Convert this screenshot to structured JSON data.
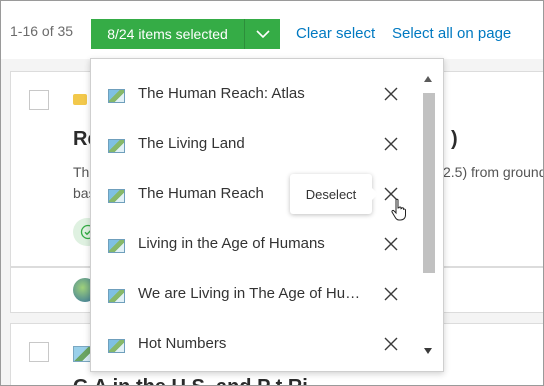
{
  "toolbar": {
    "count": "1-16 of 35",
    "selected_label": "8/24 items selected",
    "clear_select": "Clear select",
    "select_all": "Select all on page"
  },
  "background": {
    "card1_title_start": "Re",
    "card1_title_end": ")",
    "card1_text_start": "Thi",
    "card1_text_end": "2.5) from ground",
    "card1_text_line2": "bas",
    "card2_title": "G     A    in the U.S. and P  t  Ri"
  },
  "dropdown": {
    "items": [
      {
        "label": "The Human Reach: Atlas"
      },
      {
        "label": "The Living Land"
      },
      {
        "label": "The Human Reach"
      },
      {
        "label": "Living in the Age of Humans"
      },
      {
        "label": "We are Living in The Age of Humans"
      },
      {
        "label": "Hot Numbers"
      }
    ]
  },
  "tooltip": {
    "text": "Deselect"
  },
  "colors": {
    "accent_green": "#35ac46",
    "link_blue": "#0079c1"
  },
  "icons": {
    "dropdown_toggle": "chevron-down-icon",
    "remove": "close-icon",
    "thumbnail": "web-map-icon",
    "cursor": "hand-pointer-icon"
  }
}
